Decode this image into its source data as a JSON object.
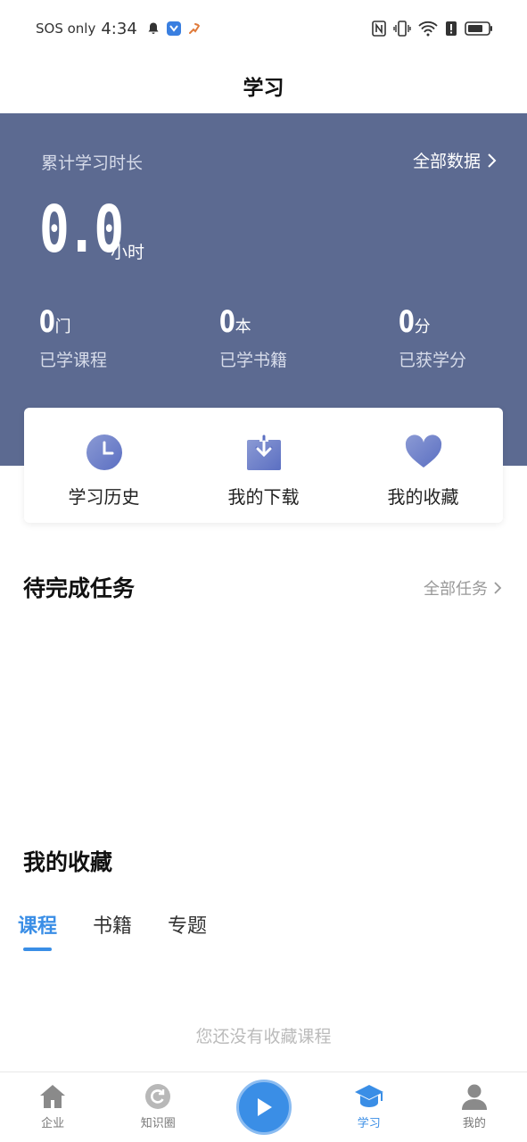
{
  "status_bar": {
    "carrier": "SOS only",
    "time": "4:34"
  },
  "header": {
    "title": "学习"
  },
  "hero": {
    "label": "累计学习时长",
    "all_data_link": "全部数据",
    "hours_value": "0.0",
    "hours_unit": "小时",
    "stats": [
      {
        "value": "0",
        "unit": "门",
        "caption": "已学课程"
      },
      {
        "value": "0",
        "unit": "本",
        "caption": "已学书籍"
      },
      {
        "value": "0",
        "unit": "分",
        "caption": "已获学分"
      }
    ]
  },
  "quick_actions": [
    {
      "label": "学习历史",
      "icon": "clock-icon"
    },
    {
      "label": "我的下载",
      "icon": "download-icon"
    },
    {
      "label": "我的收藏",
      "icon": "heart-icon"
    }
  ],
  "tasks": {
    "title": "待完成任务",
    "all_link": "全部任务"
  },
  "favorites": {
    "title": "我的收藏",
    "tabs": [
      "课程",
      "书籍",
      "专题"
    ],
    "active_tab": "课程",
    "empty_text": "您还没有收藏课程"
  },
  "bottom_nav": {
    "items": [
      {
        "label": "企业",
        "icon": "home-icon"
      },
      {
        "label": "知识圈",
        "icon": "refresh-circle-icon"
      },
      {
        "label": "",
        "icon": "play-icon"
      },
      {
        "label": "学习",
        "icon": "graduation-cap-icon"
      },
      {
        "label": "我的",
        "icon": "user-icon"
      }
    ],
    "active": "学习"
  },
  "colors": {
    "hero_bg": "#5c6a91",
    "accent": "#3a8ee6",
    "icon_gradient_start": "#8b9ad4",
    "icon_gradient_end": "#5b6fc2"
  }
}
